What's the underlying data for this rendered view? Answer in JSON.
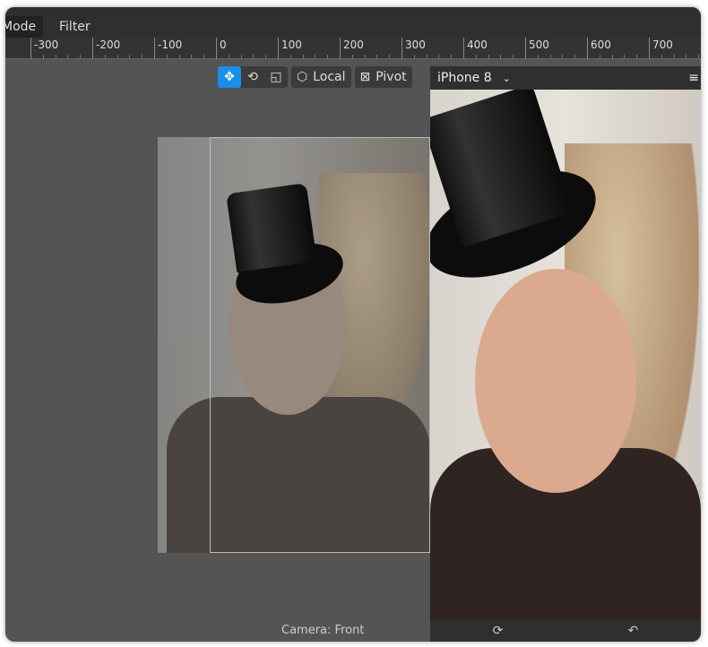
{
  "menu": {
    "items": [
      "Mode",
      "Filter"
    ]
  },
  "ruler": {
    "labels": [
      "-300",
      "-200",
      "-100",
      "0",
      "100",
      "200",
      "300",
      "400",
      "500",
      "600",
      "700"
    ]
  },
  "toolbar": {
    "move_icon": "move-icon",
    "rotate_icon": "rotate-icon",
    "scale_icon": "scale-icon",
    "local_label": "Local",
    "pivot_label": "Pivot",
    "accent": "#1a8ee8"
  },
  "simulator": {
    "device": "iPhone 8",
    "menu_icon": "hamburger-icon",
    "footer": {
      "flip_camera_icon": "camera-flip-icon",
      "rotate_icon": "rotate-device-icon"
    }
  },
  "viewport": {
    "camera_label": "Camera: Front"
  }
}
